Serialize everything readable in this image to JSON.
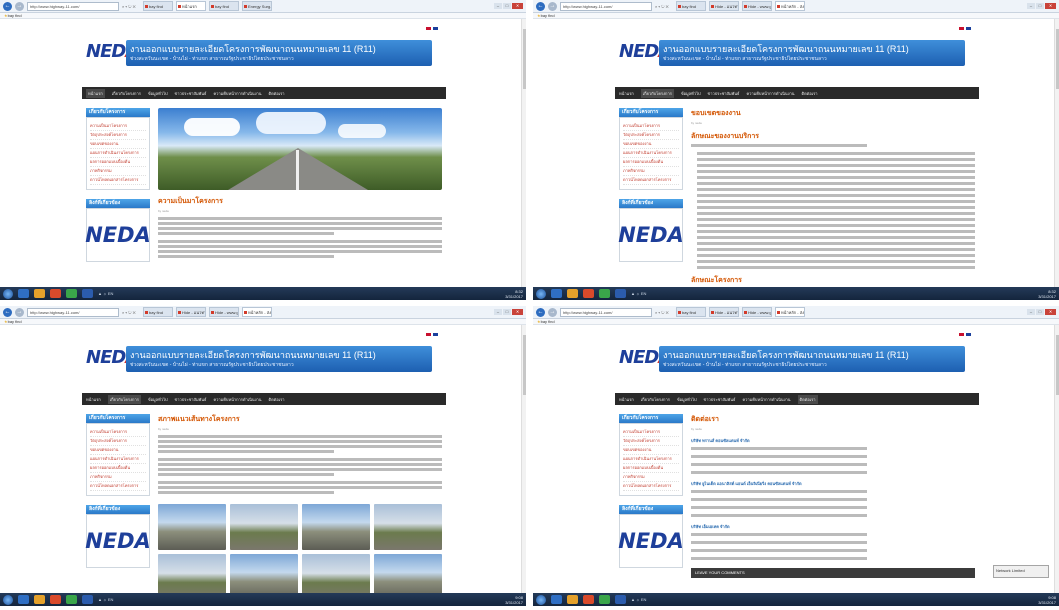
{
  "browser": {
    "url_1": "http://www.highway-11.com/",
    "url_2": "http://www.highway-11.com/",
    "url_3": "http://www.highway-11.com/",
    "url_4": "http://www.highway-11.com/",
    "addr_tools": "⌕ ▾ ↻ ✕",
    "tabs": [
      "bay find",
      "หน้าแรก",
      "bay find",
      "Energy Surg...",
      "Hide - แนวทาง",
      "Hide - www.go...",
      "หน้าหลัก - ส่ง..."
    ],
    "favorites_label": "bay find",
    "win_min": "–",
    "win_max": "□",
    "win_close": "✕"
  },
  "site": {
    "logo_main": "NED",
    "logo_accent": "A",
    "banner_title": "งานออกแบบรายละเอียดโครงการพัฒนาถนนหมายเลข 11 (R11)",
    "banner_subtitle": "ช่วงสะหวันนะเขต - บ้านไผ่ - ท่าแขก สาธารณรัฐประชาธิปไตยประชาชนลาว",
    "menu": [
      "หน้าแรก",
      "เกี่ยวกับโครงการ",
      "ข้อมูลทั่วไป",
      "ข่าวประชาสัมพันธ์",
      "ความคืบหน้าการดำเนินงาน",
      "ติดต่อเรา"
    ],
    "sidebar_heading": "เกี่ยวกับโครงการ",
    "sidebar_items": [
      "ความเป็นมาโครงการ",
      "วัตถุประสงค์โครงการ",
      "ขอบเขตของงาน",
      "แผนการดำเนินงานโครงการ",
      "ผลการออกแบบเบื้องต้น",
      "ภาพกิจกรรม",
      "ดาวน์โหลดเอกสารโครงการ"
    ],
    "sidebar_heading_2": "ลิงก์ที่เกี่ยวข้อง",
    "sidebar_logo": "NEDA"
  },
  "panes": {
    "p1": {
      "heading": "ความเป็นมาโครงการ",
      "sub": "by neda"
    },
    "p2": {
      "heading": "ขอบเขตของงาน",
      "sub": "by neda",
      "section_1": "ลักษณะของงานบริการ",
      "section_2": "ลักษณะโครงการ"
    },
    "p3": {
      "heading": "สภาพแนวเส้นทางโครงการ",
      "sub": "by neda"
    },
    "p4": {
      "heading": "ติดต่อเรา",
      "sub": "by neda",
      "contacts": [
        "บริษัท ทรานส์ คอนซัลแตนท์ จำกัด",
        "บริษัท ยูไนเต็ด แอนาลิสต์ แอนด์ เอ็นจิเนียริ่ง คอนซัลแตนท์ จำกัด",
        "บริษัท เอ็มเอเทค จำกัด"
      ],
      "comment_bar": "LEAVE YOUR COMMENTS"
    }
  },
  "taskbar": {
    "clock_1": "8:32",
    "date_1": "3/31/2017",
    "clock_2": "9:08",
    "date_2": "3/31/2017",
    "tray": "▲ ☼ EN",
    "notification": "Network Limited"
  },
  "colors": {
    "accent_blue": "#2a79c8",
    "menu_dark": "#2a2a2a",
    "heading_orange": "#d35400",
    "logo_blue": "#1e3f9a",
    "logo_red": "#d32f2f"
  }
}
